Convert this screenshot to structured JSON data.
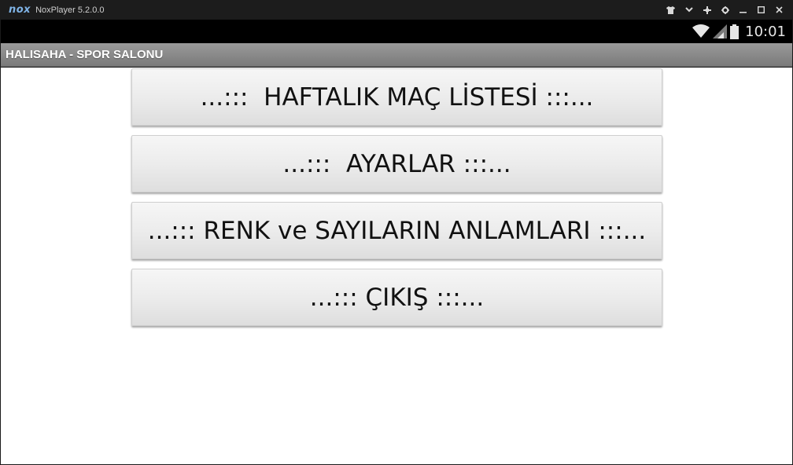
{
  "window": {
    "logo": "nox",
    "title": "NoxPlayer 5.2.0.0",
    "controls": [
      "shirt-icon",
      "chevron-down-icon",
      "pin-icon",
      "gear-icon",
      "minimize-icon",
      "maximize-icon",
      "close-icon"
    ]
  },
  "status_bar": {
    "time": "10:01",
    "icons": [
      "wifi-icon",
      "signal-icon",
      "battery-icon"
    ]
  },
  "action_bar": {
    "title": "HALISAHA - SPOR SALONU"
  },
  "menu": [
    {
      "label": "...:::  HAFTALIK MAÇ LİSTESİ :::..."
    },
    {
      "label": "...:::  AYARLAR :::..."
    },
    {
      "label": "...::: RENK ve SAYILARIN ANLAMLARI :::..."
    },
    {
      "label": "...::: ÇIKIŞ :::..."
    }
  ],
  "colors": {
    "titlebar": "#1c1c1c",
    "statusbar": "#000000",
    "actionbar": "#8a8a8a",
    "content_bg": "#ffffff",
    "button_bg": "#ececec"
  }
}
